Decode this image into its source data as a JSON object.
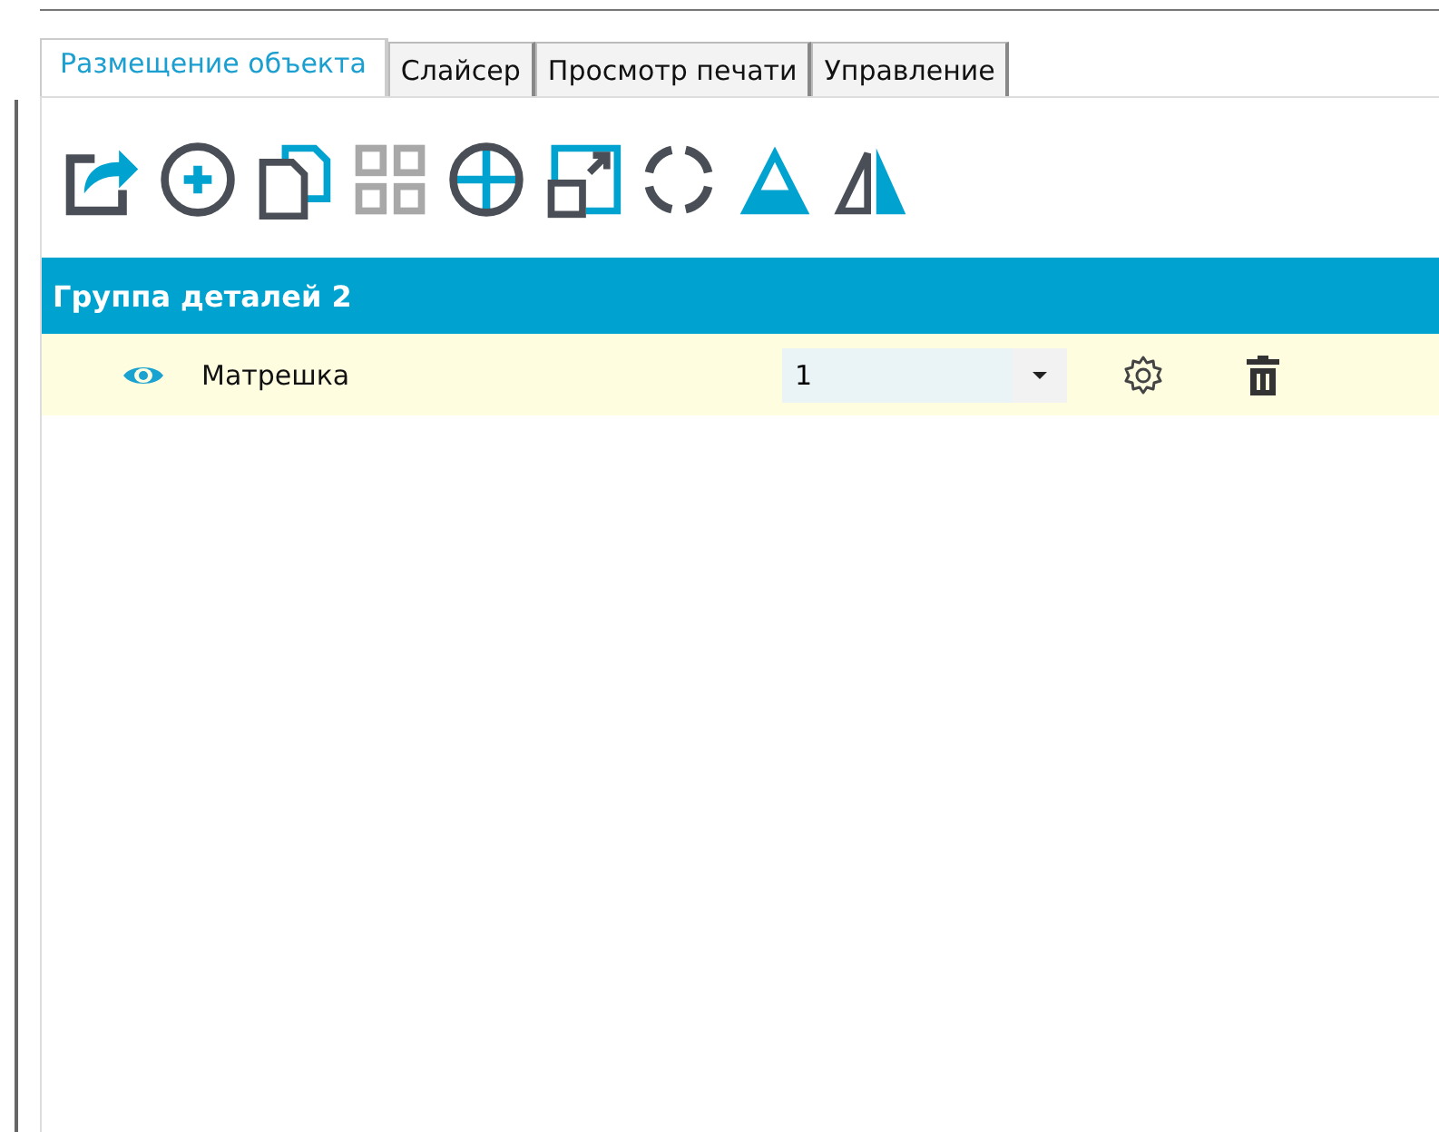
{
  "tabs": [
    {
      "label": "Размещение объекта",
      "selected": true
    },
    {
      "label": "Слайсер",
      "selected": false
    },
    {
      "label": "Просмотр печати",
      "selected": false
    },
    {
      "label": "Управление",
      "selected": false
    }
  ],
  "toolbar": [
    {
      "kind": "export",
      "disabled": false
    },
    {
      "kind": "add",
      "disabled": false
    },
    {
      "kind": "copy",
      "disabled": false
    },
    {
      "kind": "arrange",
      "disabled": true
    },
    {
      "kind": "center",
      "disabled": false
    },
    {
      "kind": "scale",
      "disabled": false
    },
    {
      "kind": "rotate",
      "disabled": false
    },
    {
      "kind": "lay-flat",
      "disabled": false
    },
    {
      "kind": "mirror",
      "disabled": false
    }
  ],
  "group": {
    "title": "Группа деталей 2",
    "items": [
      {
        "name": "Матрешка",
        "visible": true,
        "value": "1"
      }
    ]
  }
}
